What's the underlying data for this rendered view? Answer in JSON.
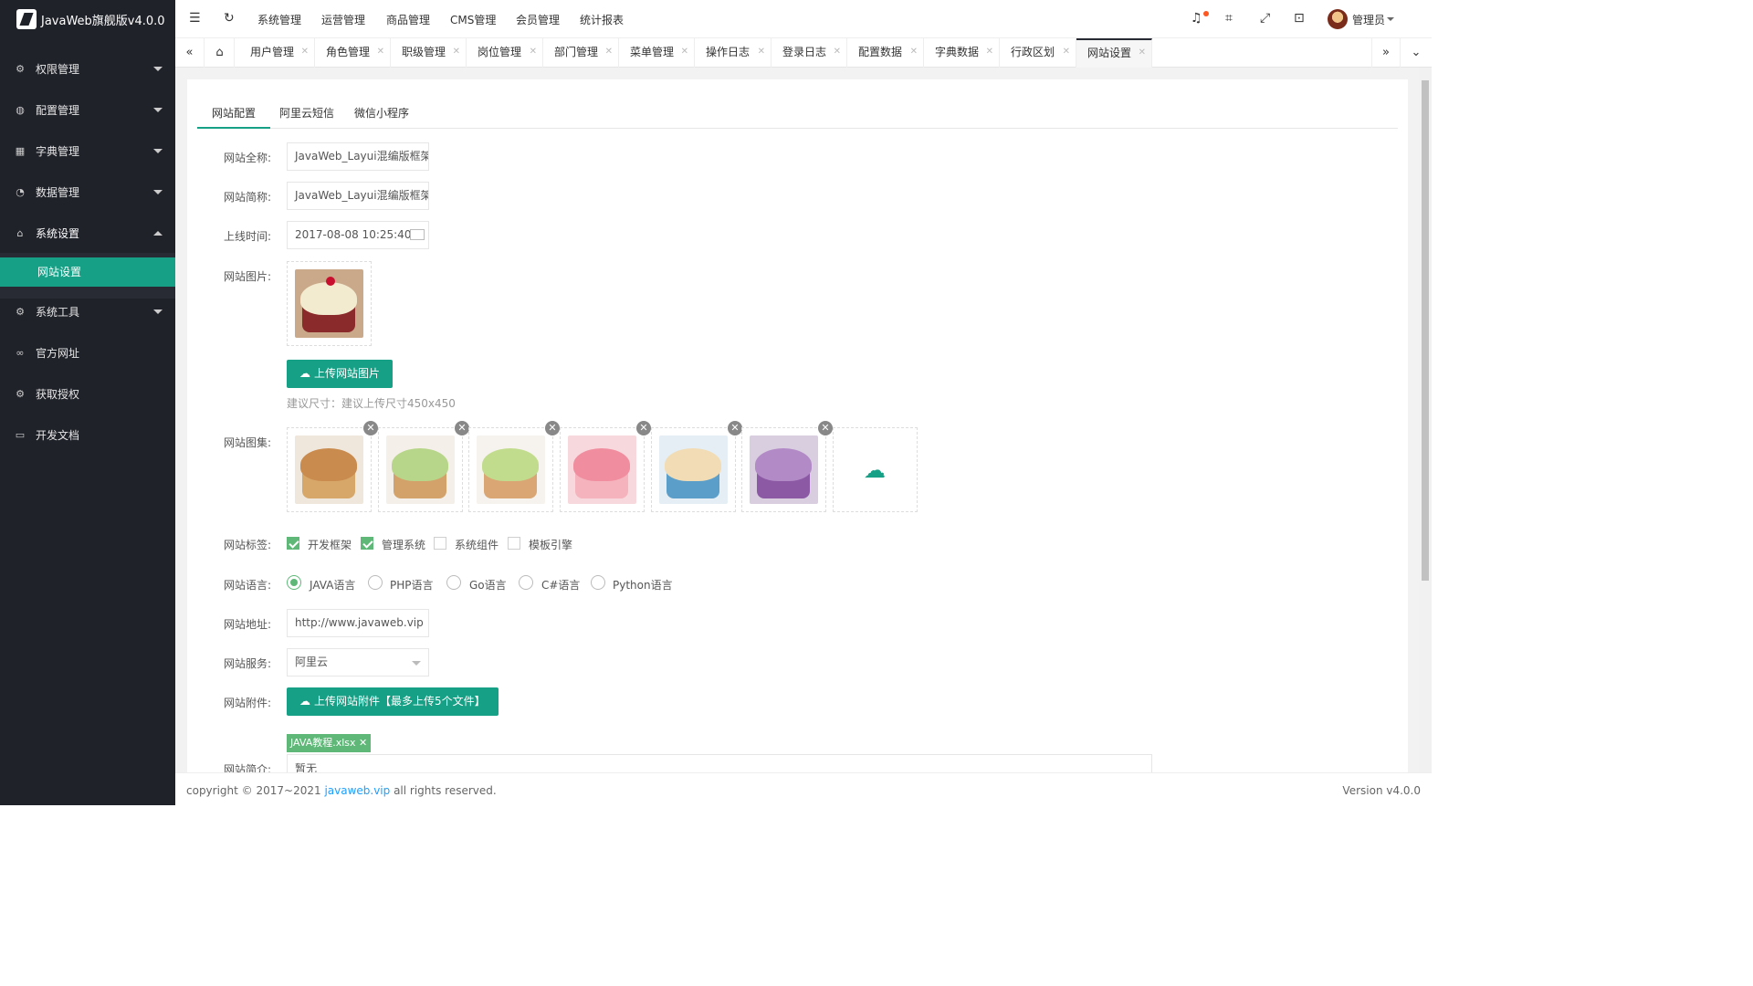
{
  "app": {
    "title": "JavaWeb旗舰版v4.0.0"
  },
  "sidebar": {
    "items": [
      {
        "label": "权限管理",
        "icon": "lock-icon"
      },
      {
        "label": "配置管理",
        "icon": "globe-icon"
      },
      {
        "label": "字典管理",
        "icon": "grid-icon"
      },
      {
        "label": "数据管理",
        "icon": "chart-icon"
      },
      {
        "label": "系统设置",
        "icon": "home-icon"
      },
      {
        "label": "系统工具",
        "icon": "gear-icon"
      },
      {
        "label": "官方网址",
        "icon": "link-icon"
      },
      {
        "label": "获取授权",
        "icon": "gear-icon"
      },
      {
        "label": "开发文档",
        "icon": "book-icon"
      }
    ],
    "active_sub": "网站设置"
  },
  "topbar": {
    "nav": [
      "系统管理",
      "运营管理",
      "商品管理",
      "CMS管理",
      "会员管理",
      "统计报表"
    ],
    "user": "管理员"
  },
  "tabs": [
    "用户管理",
    "角色管理",
    "职级管理",
    "岗位管理",
    "部门管理",
    "菜单管理",
    "操作日志",
    "登录日志",
    "配置数据",
    "字典数据",
    "行政区划",
    "网站设置"
  ],
  "subtabs": [
    "网站配置",
    "阿里云短信",
    "微信小程序"
  ],
  "form": {
    "full_name_label": "网站全称:",
    "full_name_value": "JavaWeb_Layui混编版框架",
    "short_name_label": "网站简称:",
    "short_name_value": "JavaWeb_Layui混编版框架",
    "online_time_label": "上线时间:",
    "online_time_value": "2017-08-08 10:25:40",
    "image_label": "网站图片:",
    "upload_image_button": "上传网站图片",
    "upload_hint": "建议尺寸：建议上传尺寸450x450",
    "gallery_label": "网站图集:",
    "tags_label": "网站标签:",
    "tags": [
      {
        "label": "开发框架",
        "checked": true
      },
      {
        "label": "管理系统",
        "checked": true
      },
      {
        "label": "系统组件",
        "checked": false
      },
      {
        "label": "模板引擎",
        "checked": false
      }
    ],
    "lang_label": "网站语言:",
    "languages": [
      {
        "label": "JAVA语言",
        "selected": true
      },
      {
        "label": "PHP语言",
        "selected": false
      },
      {
        "label": "Go语言",
        "selected": false
      },
      {
        "label": "C#语言",
        "selected": false
      },
      {
        "label": "Python语言",
        "selected": false
      }
    ],
    "url_label": "网站地址:",
    "url_value": "http://www.javaweb.vip",
    "service_label": "网站服务:",
    "service_value": "阿里云",
    "attach_label": "网站附件:",
    "upload_attach_button": "上传网站附件【最多上传5个文件】",
    "attach_file": "JAVA教程.xlsx",
    "intro_label": "网站简介:",
    "intro_value": "暂无"
  },
  "footer": {
    "copyright_prefix": "copyright © 2017~2021 ",
    "link": "javaweb.vip",
    "copyright_suffix": " all rights reserved.",
    "version": "Version v4.0.0"
  }
}
